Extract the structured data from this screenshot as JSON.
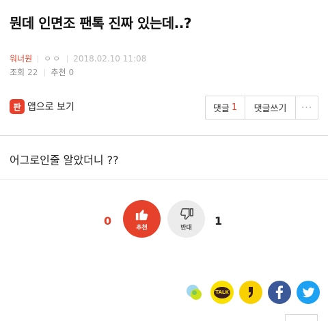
{
  "post": {
    "title": "뭔데 인면조 팬톡 진짜 있는데..?",
    "author": "워너원",
    "author_sub": "ㅇㅇ",
    "date": "2018.02.10 11:08",
    "views_label": "조회",
    "views": "22",
    "recommend_label": "추천",
    "recommend": "0",
    "body": "어그로인줄 알았더니 ??"
  },
  "actions": {
    "app_badge": "판",
    "app_view_label": "앱으로 보기",
    "comment_label": "댓글",
    "comment_count": "1",
    "write_comment_label": "댓글쓰기",
    "more_label": "···"
  },
  "votes": {
    "up_count": "0",
    "up_label": "추천",
    "down_label": "반대",
    "down_count": "1"
  },
  "share": {
    "kakaotalk_label": "TALK"
  },
  "colors": {
    "accent": "#e0412a",
    "facebook": "#3b5998",
    "twitter": "#1da1f2",
    "kakao": "#f9e000"
  }
}
